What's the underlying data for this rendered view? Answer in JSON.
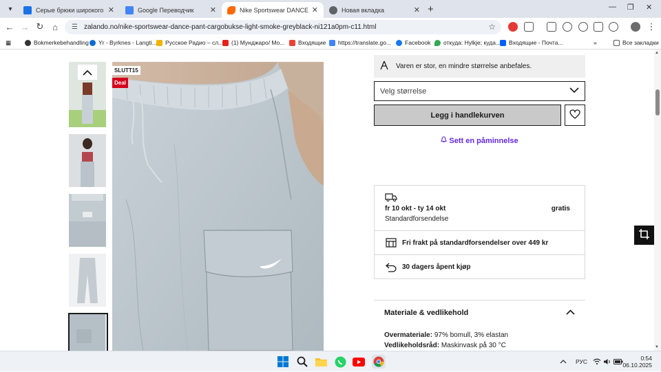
{
  "browser": {
    "tabs": [
      {
        "title": "Серые брюки широкого крои",
        "color": "#1a73e8",
        "active": false
      },
      {
        "title": "Google Переводчик",
        "color": "#4285f4",
        "active": false
      },
      {
        "title": "Nike Sportswear DANCE PANT",
        "color": "#ff6900",
        "active": true
      },
      {
        "title": "Новая вкладка",
        "color": "#5f6368",
        "active": false
      }
    ],
    "url": "zalando.no/nike-sportswear-dance-pant-cargobukse-light-smoke-greyblack-ni121a0pm-c11.html",
    "bookmarks": [
      {
        "label": "Bokmerkebehandling",
        "color": "#333333"
      },
      {
        "label": "Yr - Byrknes - Langti...",
        "color": "#0a6dd6"
      },
      {
        "label": "Русское Радио – сл...",
        "color": "#f0b400"
      },
      {
        "label": "(1) Мунджаро/ Мо...",
        "color": "#e62117"
      },
      {
        "label": "Входящие",
        "color": "#ea4335"
      },
      {
        "label": "https://translate.go...",
        "color": "#4285f4"
      },
      {
        "label": "Facebook",
        "color": "#1877f2"
      },
      {
        "label": "откуда: Hylkje; куда...",
        "color": "#34a853"
      },
      {
        "label": "Входящие - Почта...",
        "color": "#005ff9"
      }
    ],
    "all_bookmarks": "Все закладки"
  },
  "product": {
    "badge_code": "SLUTT15",
    "badge_deal": "Deal",
    "size_hint": "Varen er stor, en mindre størrelse anbefales.",
    "size_select_placeholder": "Velg størrelse",
    "add_to_cart": "Legg i handlekurven",
    "reminder": "Sett en påminnelse"
  },
  "delivery": {
    "dates": "fr 10 okt - ty 14 okt",
    "price": "gratis",
    "method": "Standardforsendelse",
    "free_shipping": "Fri frakt på standardforsendelser over 449 kr",
    "returns": "30 dagers åpent kjøp"
  },
  "material": {
    "heading": "Materiale & vedlikehold",
    "outer_label": "Overmateriale:",
    "outer_value": "97% bomull, 3% elastan",
    "care_label": "Vedlikeholdsråd:",
    "care_value": "Maskinvask på 30 °C"
  },
  "taskbar": {
    "lang": "РУС",
    "time": "0:54",
    "date": "06.10.2025"
  }
}
